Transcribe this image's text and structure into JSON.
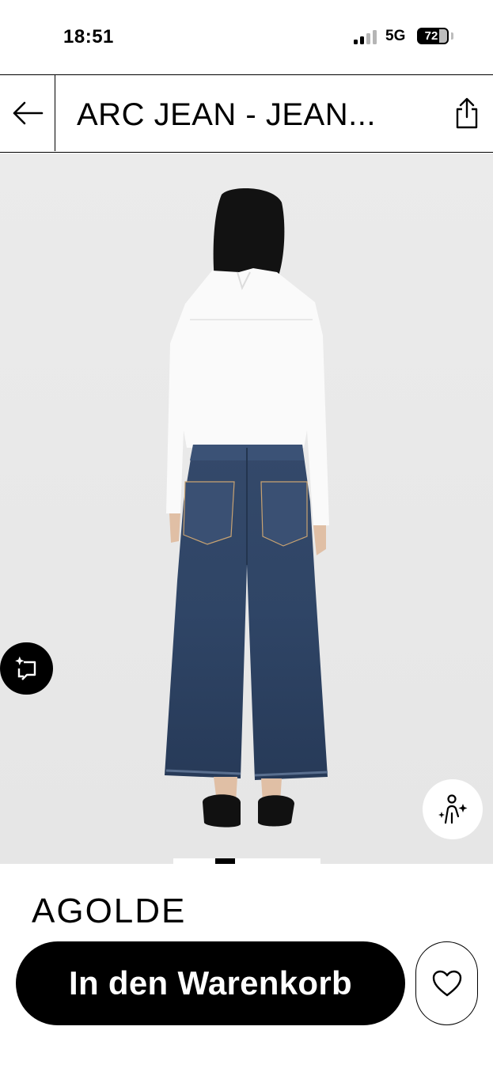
{
  "status_bar": {
    "time": "18:51",
    "network": "5G",
    "battery": "72",
    "battery_level": 0.72
  },
  "header": {
    "title": "ARC JEAN - JEAN...",
    "back_icon": "arrow-left-icon",
    "share_icon": "share-icon"
  },
  "product": {
    "brand": "AGOLDE",
    "compare_icon": "crop-sparkle-icon",
    "tryon_icon": "person-sparkle-icon",
    "carousel": {
      "count": 7,
      "active": 2
    }
  },
  "actions": {
    "add_to_cart_label": "In den Warenkorb",
    "wishlist_icon": "heart-icon"
  },
  "colors": {
    "background": "#ffffff",
    "image_background": "#ececec",
    "primary": "#000000"
  }
}
